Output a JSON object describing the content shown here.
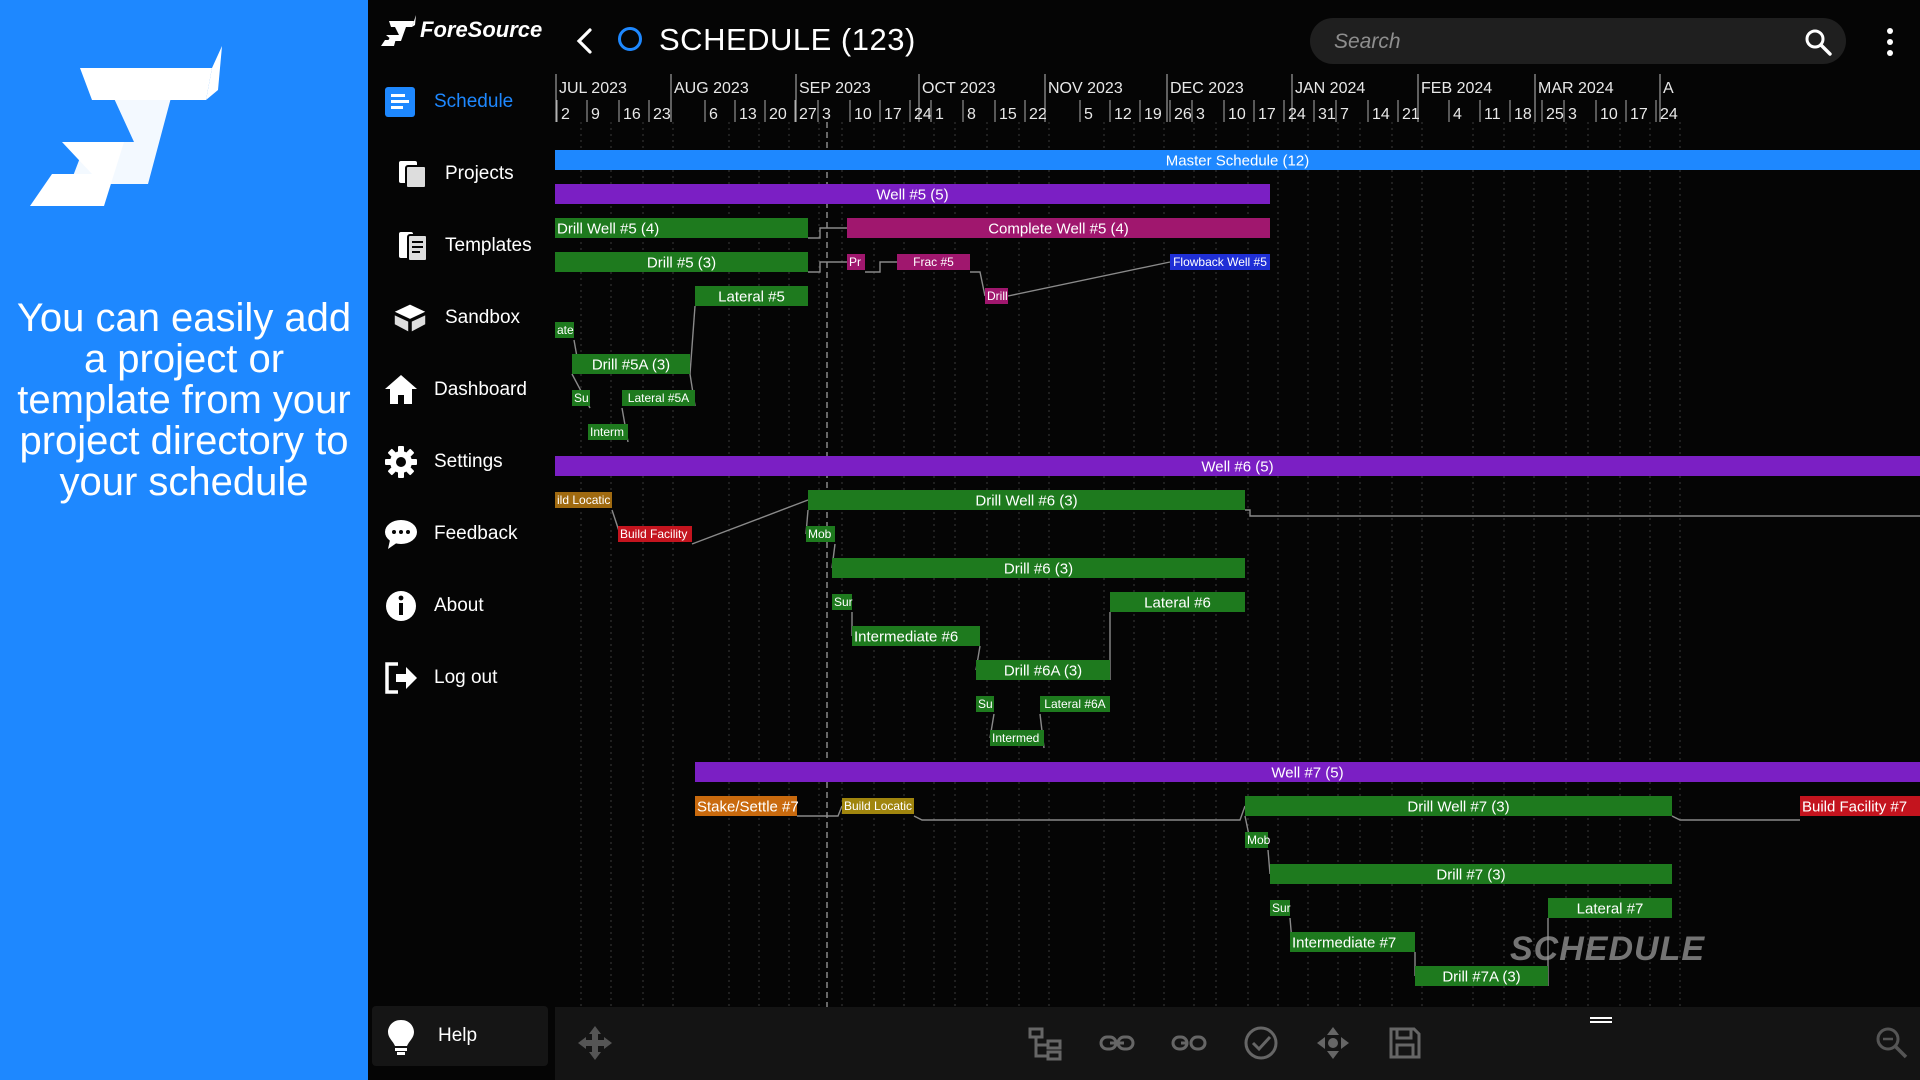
{
  "promo": {
    "text": "You can easily add a project or template from your project directory to your schedule"
  },
  "brand": {
    "name": "ForeSource"
  },
  "header": {
    "title": "SCHEDULE (123)"
  },
  "search": {
    "placeholder": "Search"
  },
  "sidebar": {
    "items": [
      {
        "label": "Schedule",
        "icon": "schedule-icon",
        "active": true
      },
      {
        "label": "Projects",
        "icon": "projects-icon"
      },
      {
        "label": "Templates",
        "icon": "templates-icon"
      },
      {
        "label": "Sandbox",
        "icon": "sandbox-icon"
      },
      {
        "label": "Dashboard",
        "icon": "home-icon"
      },
      {
        "label": "Settings",
        "icon": "gear-icon"
      },
      {
        "label": "Feedback",
        "icon": "chat-bubble-icon"
      },
      {
        "label": "About",
        "icon": "info-icon"
      },
      {
        "label": "Log out",
        "icon": "logout-icon"
      }
    ],
    "help_label": "Help"
  },
  "timeline": {
    "months": [
      "JUL 2023",
      "AUG 2023",
      "SEP 2023",
      "OCT 2023",
      "NOV 2023",
      "DEC 2023",
      "JAN 2024",
      "FEB 2024",
      "MAR 2024",
      "A"
    ],
    "weeks": [
      "2",
      "9",
      "16",
      "23",
      "6",
      "13",
      "20",
      "27",
      "3",
      "10",
      "17",
      "24",
      "1",
      "8",
      "15",
      "22",
      "5",
      "12",
      "19",
      "26",
      "3",
      "10",
      "17",
      "24",
      "31",
      "7",
      "14",
      "21",
      "4",
      "11",
      "18",
      "25",
      "3",
      "10",
      "17",
      "24"
    ]
  },
  "tasks": [
    {
      "label": "Master Schedule (12)",
      "color": "#1e88ff"
    },
    {
      "label": "Well #5 (5)",
      "color": "#7b1fc4"
    },
    {
      "label": "Drill Well #5 (4)",
      "color": "#1e7a1e"
    },
    {
      "label": "Complete Well #5 (4)",
      "color": "#a0176e"
    },
    {
      "label": "Drill #5 (3)",
      "color": "#1e7a1e"
    },
    {
      "label": "Pr",
      "color": "#a0176e"
    },
    {
      "label": "Frac #5",
      "color": "#a0176e"
    },
    {
      "label": "Flowback Well #5",
      "color": "#1f2fd6"
    },
    {
      "label": "Lateral #5",
      "color": "#1e7a1e"
    },
    {
      "label": "Drill",
      "color": "#a0176e"
    },
    {
      "label": "ate",
      "color": "#1e7a1e"
    },
    {
      "label": "Drill #5A (3)",
      "color": "#1e7a1e"
    },
    {
      "label": "Su",
      "color": "#1e7a1e"
    },
    {
      "label": "Lateral #5A",
      "color": "#1e7a1e"
    },
    {
      "label": "Interm",
      "color": "#1e7a1e"
    },
    {
      "label": "Well #6 (5)",
      "color": "#7b1fc4"
    },
    {
      "label": "ild Locatic",
      "color": "#a06a10"
    },
    {
      "label": "Drill Well #6 (3)",
      "color": "#1e7a1e"
    },
    {
      "label": "Build Facility",
      "color": "#c4141e"
    },
    {
      "label": "Mob",
      "color": "#1e7a1e"
    },
    {
      "label": "Drill #6 (3)",
      "color": "#1e7a1e"
    },
    {
      "label": "Sur",
      "color": "#1e7a1e"
    },
    {
      "label": "Lateral #6",
      "color": "#1e7a1e"
    },
    {
      "label": "Intermediate #6",
      "color": "#1e7a1e"
    },
    {
      "label": "Drill #6A (3)",
      "color": "#1e7a1e"
    },
    {
      "label": "Su",
      "color": "#1e7a1e"
    },
    {
      "label": "Lateral #6A",
      "color": "#1e7a1e"
    },
    {
      "label": "Intermed",
      "color": "#1e7a1e"
    },
    {
      "label": "Well #7 (5)",
      "color": "#7b1fc4"
    },
    {
      "label": "Stake/Settle #7",
      "color": "#c96a0e"
    },
    {
      "label": "Build Locatic",
      "color": "#a0850e"
    },
    {
      "label": "Drill Well #7 (3)",
      "color": "#1e7a1e"
    },
    {
      "label": "Build Facility #7",
      "color": "#c4141e"
    },
    {
      "label": "Mob",
      "color": "#1e7a1e"
    },
    {
      "label": "Drill #7 (3)",
      "color": "#1e7a1e"
    },
    {
      "label": "Sur",
      "color": "#1e7a1e"
    },
    {
      "label": "Lateral #7",
      "color": "#1e7a1e"
    },
    {
      "label": "Intermediate #7",
      "color": "#1e7a1e"
    },
    {
      "label": "Drill #7A (3)",
      "color": "#1e7a1e"
    }
  ],
  "watermark": "SCHEDULE",
  "toolbar": {
    "tools": [
      "move-icon",
      "hierarchy-icon",
      "link-icon",
      "unlink-icon",
      "check-circle-icon",
      "pan-icon",
      "save-icon",
      "zoom-icon"
    ]
  },
  "colors": {
    "accent": "#1e88ff",
    "background": "#050505"
  }
}
